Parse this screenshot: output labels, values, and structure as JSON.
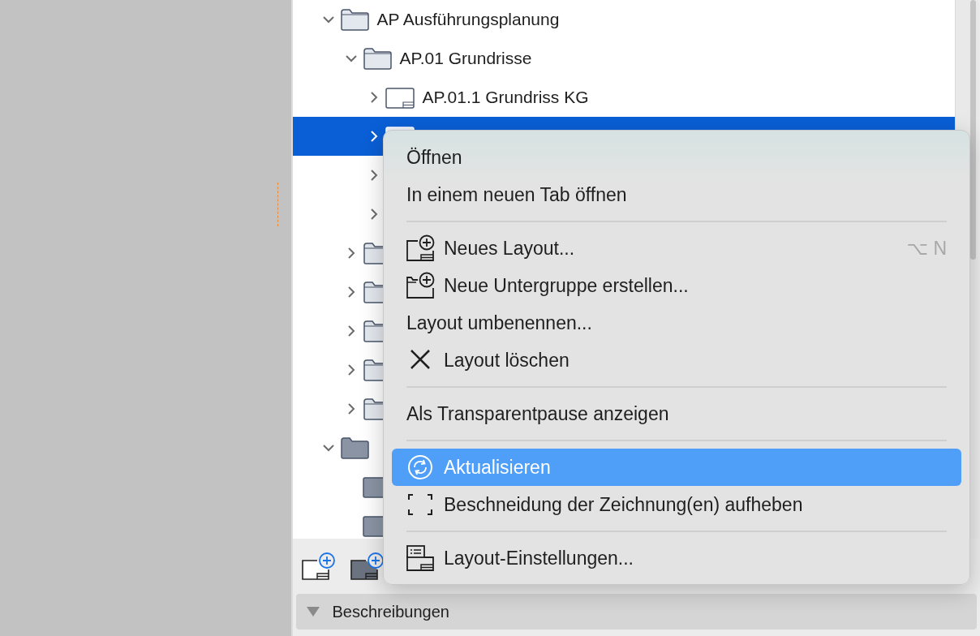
{
  "tree": [
    {
      "label": "AP Ausführungsplanung",
      "kind": "folder",
      "expanded": true,
      "selected": false,
      "children": [
        {
          "label": "AP.01 Grundrisse",
          "kind": "folder",
          "expanded": true,
          "selected": false,
          "children": [
            {
              "label": "AP.01.1 Grundriss KG",
              "kind": "layout",
              "expanded": false,
              "selected": false
            },
            {
              "kind": "layout",
              "expanded": false,
              "selected": true
            },
            {
              "expanded": false,
              "selected": false
            },
            {
              "expanded": false,
              "selected": false
            }
          ]
        },
        {
          "kind": "folder",
          "expanded": false,
          "selected": false
        },
        {
          "kind": "folder",
          "expanded": false,
          "selected": false
        },
        {
          "kind": "folder",
          "expanded": false,
          "selected": false
        },
        {
          "kind": "folder",
          "expanded": false,
          "selected": false
        },
        {
          "kind": "folder",
          "expanded": false,
          "selected": false
        }
      ]
    },
    {
      "kind": "folder-dark",
      "expanded": true,
      "selected": false,
      "children": [
        {
          "kind": "layout-dark",
          "selected": false
        },
        {
          "kind": "layout-dark",
          "selected": false
        }
      ]
    }
  ],
  "toolbar": [
    {
      "kind": "new-layout"
    },
    {
      "kind": "new-layout-dark"
    }
  ],
  "section": {
    "label": "Beschreibungen"
  },
  "context_menu": [
    {
      "kind": "item",
      "label": "Öffnen",
      "selected": false
    },
    {
      "kind": "item",
      "label": "In einem neuen Tab öffnen",
      "selected": false
    },
    {
      "kind": "separator"
    },
    {
      "kind": "new-layout",
      "label": "Neues Layout...",
      "shortcut": "⌥ N",
      "selected": false
    },
    {
      "kind": "new-group",
      "label": "Neue Untergruppe erstellen...",
      "selected": false
    },
    {
      "kind": "item",
      "label": "Layout umbenennen...",
      "selected": false
    },
    {
      "kind": "delete",
      "label": "Layout löschen",
      "selected": false
    },
    {
      "kind": "separator"
    },
    {
      "kind": "item",
      "label": "Als Transparentpause anzeigen",
      "selected": false
    },
    {
      "kind": "separator"
    },
    {
      "kind": "refresh",
      "label": "Aktualisieren",
      "selected": true
    },
    {
      "kind": "crop",
      "label": "Beschneidung der Zeichnung(en) aufheben",
      "selected": false
    },
    {
      "kind": "separator"
    },
    {
      "kind": "settings",
      "label": "Layout-Einstellungen...",
      "selected": false
    }
  ]
}
